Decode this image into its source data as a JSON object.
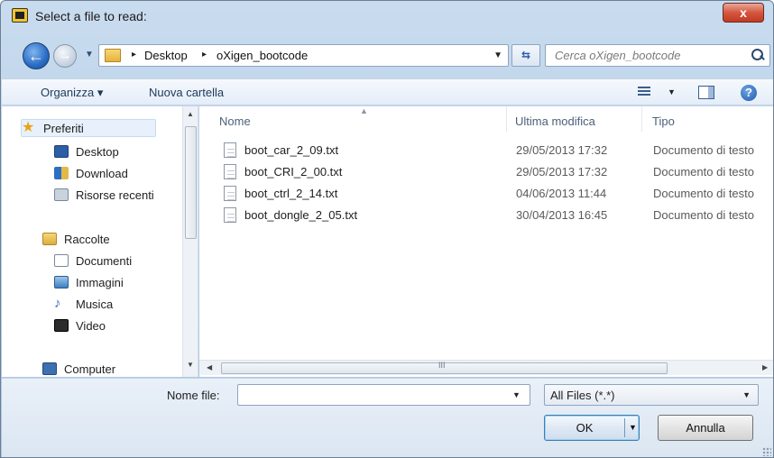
{
  "window": {
    "title": "Select a file to read:",
    "close_label": "x"
  },
  "address_bar": {
    "crumbs": [
      "Desktop",
      "oXigen_bootcode"
    ],
    "separator": "▸",
    "search_placeholder": "Cerca oXigen_bootcode"
  },
  "toolbar": {
    "organize": "Organizza ▾",
    "new_folder": "Nuova cartella",
    "help": "?"
  },
  "nav_pane": {
    "favorites_header": "Preferiti",
    "favorites": [
      "Desktop",
      "Download",
      "Risorse recenti"
    ],
    "libraries_header": "Raccolte",
    "libraries": [
      "Documenti",
      "Immagini",
      "Musica",
      "Video"
    ],
    "computer": "Computer"
  },
  "file_list": {
    "columns": {
      "name": "Nome",
      "modified": "Ultima modifica",
      "type": "Tipo"
    },
    "files": [
      {
        "name": "boot_car_2_09.txt",
        "modified": "29/05/2013 17:32",
        "type": "Documento di testo"
      },
      {
        "name": "boot_CRI_2_00.txt",
        "modified": "29/05/2013 17:32",
        "type": "Documento di testo"
      },
      {
        "name": "boot_ctrl_2_14.txt",
        "modified": "04/06/2013 11:44",
        "type": "Documento di testo"
      },
      {
        "name": "boot_dongle_2_05.txt",
        "modified": "30/04/2013 16:45",
        "type": "Documento di testo"
      }
    ],
    "hscroll_grip": "III"
  },
  "bottom": {
    "filename_label": "Nome file:",
    "filename_value": "",
    "filter_value": "All Files (*.*)",
    "ok_label": "OK",
    "cancel_label": "Annulla"
  },
  "colors": {
    "accent": "#2a6bc4",
    "close": "#c23a22",
    "window_frame": "#b7cde6"
  },
  "icons": [
    "app-icon",
    "back-icon",
    "forward-icon",
    "folder-icon",
    "refresh-icon",
    "search-icon",
    "views-icon",
    "preview-pane-icon",
    "help-icon",
    "star-icon",
    "desktop-icon",
    "download-icon",
    "recent-icon",
    "library-icon",
    "document-icon",
    "image-icon",
    "music-icon",
    "video-icon",
    "computer-icon",
    "text-file-icon"
  ]
}
